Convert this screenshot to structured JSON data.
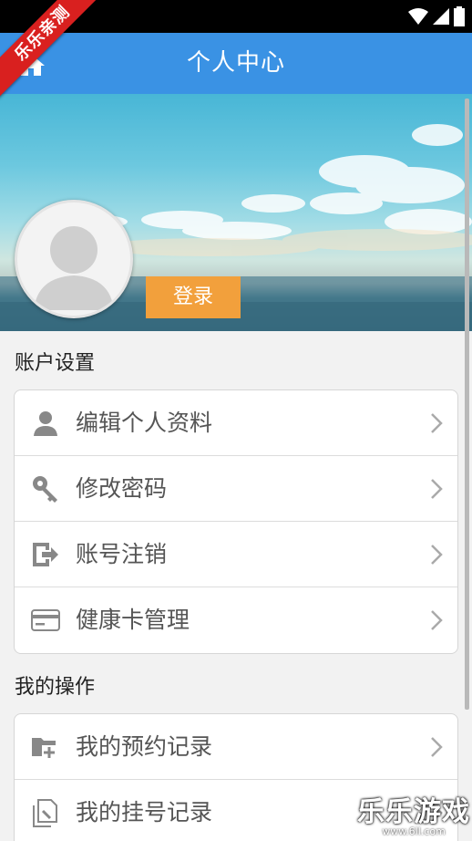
{
  "corner_badge": "乐乐亲测",
  "header": {
    "title": "个人中心",
    "home_icon": "home-icon"
  },
  "profile": {
    "login_label": "登录",
    "avatar_icon": "default-avatar"
  },
  "account_section": {
    "title": "账户设置",
    "items": [
      {
        "label": "编辑个人资料",
        "icon": "user-icon"
      },
      {
        "label": "修改密码",
        "icon": "key-icon"
      },
      {
        "label": "账号注销",
        "icon": "logout-icon"
      },
      {
        "label": "健康卡管理",
        "icon": "card-icon"
      }
    ]
  },
  "operations_section": {
    "title": "我的操作",
    "items": [
      {
        "label": "我的预约记录",
        "icon": "folder-plus-icon"
      },
      {
        "label": "我的挂号记录",
        "icon": "document-icon"
      }
    ]
  },
  "watermark": {
    "text": "乐乐游戏",
    "sub": "www.6ll.com"
  },
  "colors": {
    "app_bar": "#3a92e4",
    "login_button": "#f2a03c",
    "badge": "#d9201f",
    "icon": "#888888"
  }
}
